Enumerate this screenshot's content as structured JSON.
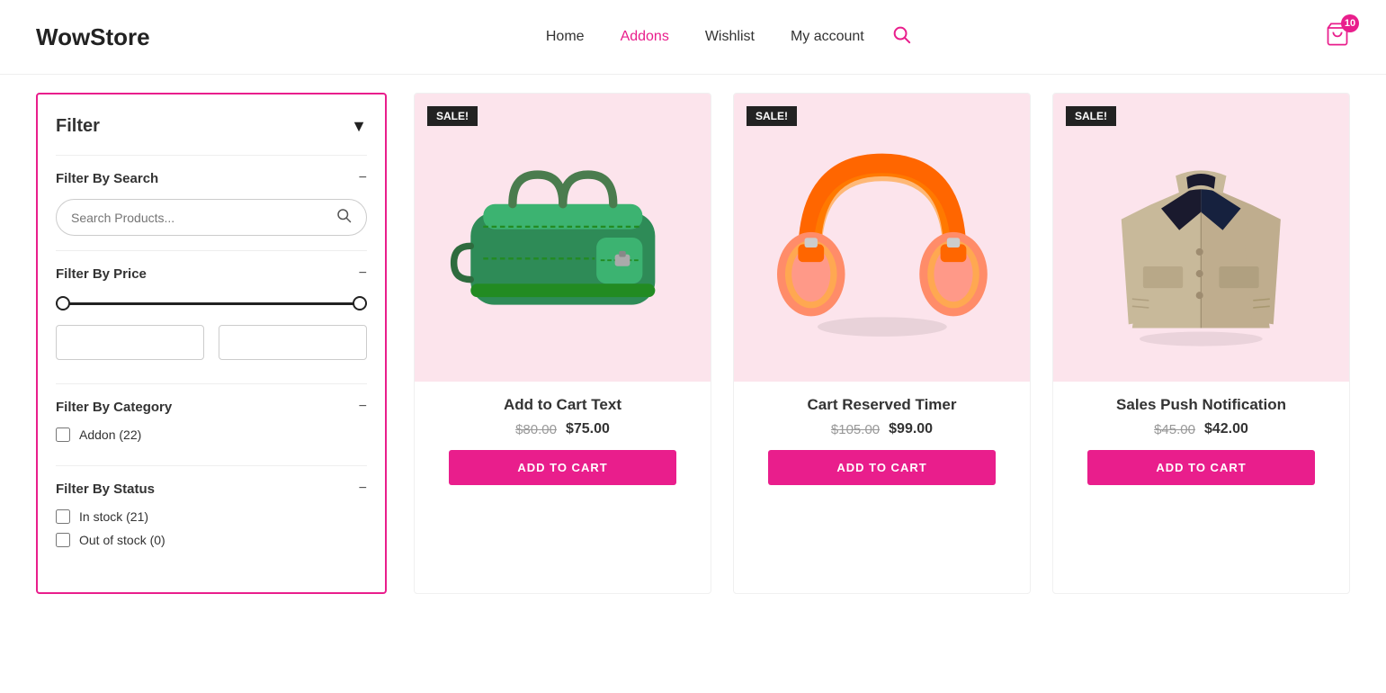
{
  "header": {
    "logo": "WowStore",
    "nav": [
      {
        "label": "Home",
        "active": false
      },
      {
        "label": "Addons",
        "active": true
      },
      {
        "label": "Wishlist",
        "active": false
      },
      {
        "label": "My account",
        "active": false
      }
    ],
    "cart_count": "10"
  },
  "sidebar": {
    "title": "Filter",
    "sections": {
      "search": {
        "title": "Filter By Search",
        "placeholder": "Search Products..."
      },
      "price": {
        "title": "Filter By Price",
        "min": "0",
        "max": "600"
      },
      "category": {
        "title": "Filter By Category",
        "items": [
          {
            "label": "Addon (22)",
            "checked": false
          }
        ]
      },
      "status": {
        "title": "Filter By Status",
        "items": [
          {
            "label": "In stock (21)",
            "checked": false
          },
          {
            "label": "Out of stock (0)",
            "checked": false
          }
        ]
      }
    }
  },
  "products": [
    {
      "id": 1,
      "name": "Add to Cart Text",
      "sale": true,
      "sale_label": "SALE!",
      "price_old": "$80.00",
      "price_new": "$75.00",
      "add_to_cart": "ADD TO CART",
      "color": "#fce4ec",
      "type": "bag"
    },
    {
      "id": 2,
      "name": "Cart Reserved Timer",
      "sale": true,
      "sale_label": "SALE!",
      "price_old": "$105.00",
      "price_new": "$99.00",
      "add_to_cart": "ADD TO CART",
      "color": "#fce4ec",
      "type": "headphones"
    },
    {
      "id": 3,
      "name": "Sales Push Notification",
      "sale": true,
      "sale_label": "SALE!",
      "price_old": "$45.00",
      "price_new": "$42.00",
      "add_to_cart": "ADD TO CART",
      "color": "#fce4ec",
      "type": "jacket"
    }
  ]
}
